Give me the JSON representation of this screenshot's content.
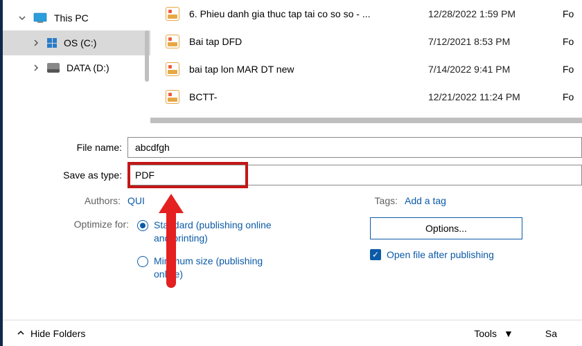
{
  "sidebar": {
    "thisPC": "This PC",
    "drives": [
      {
        "label": "OS (C:)",
        "selected": true
      },
      {
        "label": "DATA (D:)",
        "selected": false
      }
    ]
  },
  "files": [
    {
      "name": "6. Phieu danh gia thuc tap tai co so so - ...",
      "date": "12/28/2022 1:59 PM",
      "type": "Fo"
    },
    {
      "name": "Bai tap DFD",
      "date": "7/12/2021 8:53 PM",
      "type": "Fo"
    },
    {
      "name": "bai tap lon MAR DT new",
      "date": "7/14/2022 9:41 PM",
      "type": "Fo"
    },
    {
      "name": "BCTT-",
      "date": "12/21/2022 11:24 PM",
      "type": "Fo"
    }
  ],
  "form": {
    "fileNameLabel": "File name:",
    "fileNameValue": "abcdfgh",
    "saveAsTypeLabel": "Save as type:",
    "saveAsTypeValue": "PDF"
  },
  "meta": {
    "authorsLabel": "Authors:",
    "authorsValue": "QUI",
    "tagsLabel": "Tags:",
    "tagsValue": "Add a tag",
    "optimizeLabel": "Optimize for:",
    "optStandard": "Standard (publishing online and printing)",
    "optMinimum": "Minimum size (publishing online)",
    "optionsBtn": "Options...",
    "openAfter": "Open file after publishing"
  },
  "bottom": {
    "hideFolders": "Hide Folders",
    "tools": "Tools",
    "save": "Sa"
  }
}
